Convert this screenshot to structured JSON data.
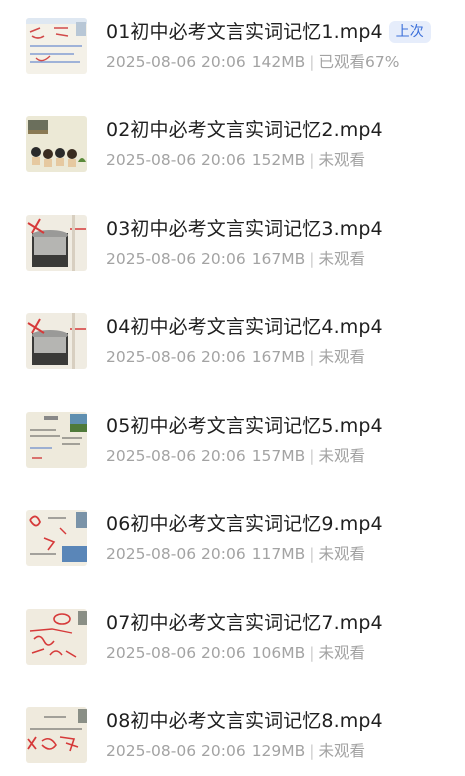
{
  "files": [
    {
      "name": "01初中必考文言实词记忆1.mp4",
      "date": "2025-08-06 20:06",
      "size": "142MB",
      "status": "已观看67%",
      "badge": "上次",
      "thumb": "thumb-1"
    },
    {
      "name": "02初中必考文言实词记忆2.mp4",
      "date": "2025-08-06 20:06",
      "size": "152MB",
      "status": "未观看",
      "badge": "",
      "thumb": "thumb-2"
    },
    {
      "name": "03初中必考文言实词记忆3.mp4",
      "date": "2025-08-06 20:06",
      "size": "167MB",
      "status": "未观看",
      "badge": "",
      "thumb": "thumb-3"
    },
    {
      "name": "04初中必考文言实词记忆4.mp4",
      "date": "2025-08-06 20:06",
      "size": "167MB",
      "status": "未观看",
      "badge": "",
      "thumb": "thumb-3"
    },
    {
      "name": "05初中必考文言实词记忆5.mp4",
      "date": "2025-08-06 20:06",
      "size": "157MB",
      "status": "未观看",
      "badge": "",
      "thumb": "thumb-5"
    },
    {
      "name": "06初中必考文言实词记忆9.mp4",
      "date": "2025-08-06 20:06",
      "size": "117MB",
      "status": "未观看",
      "badge": "",
      "thumb": "thumb-6"
    },
    {
      "name": "07初中必考文言实词记忆7.mp4",
      "date": "2025-08-06 20:06",
      "size": "106MB",
      "status": "未观看",
      "badge": "",
      "thumb": "thumb-7"
    },
    {
      "name": "08初中必考文言实词记忆8.mp4",
      "date": "2025-08-06 20:06",
      "size": "129MB",
      "status": "未观看",
      "badge": "",
      "thumb": "thumb-8"
    }
  ],
  "colors": {
    "title": "#1f1f1f",
    "meta": "#a3a3a3",
    "badge_bg": "#e6edfb",
    "badge_text": "#3b6fd9"
  }
}
